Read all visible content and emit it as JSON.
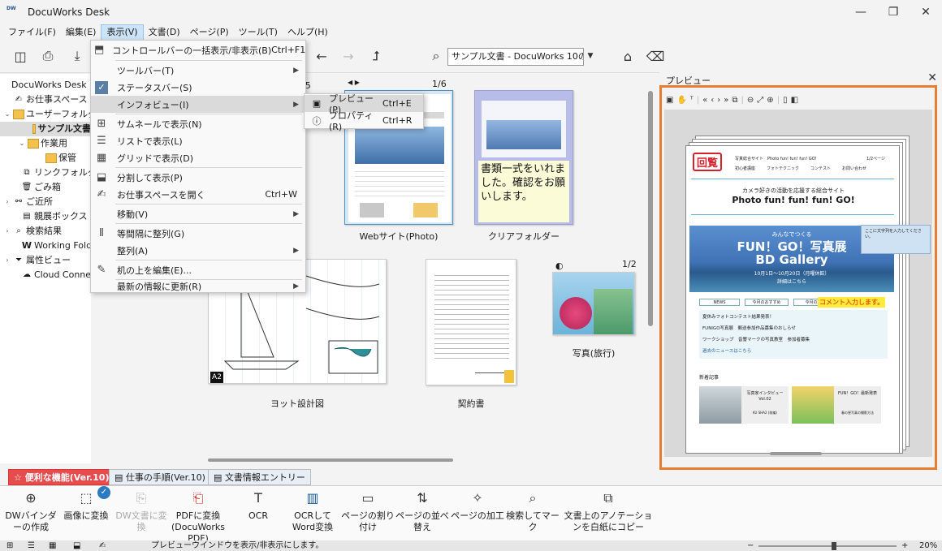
{
  "app": {
    "title": "DocuWorks Desk",
    "logo_text": "DW"
  },
  "window_controls": {
    "minimize": "—",
    "maximize": "❐",
    "close": "✕"
  },
  "menu": [
    "ファイル(F)",
    "編集(E)",
    "表示(V)",
    "文書(D)",
    "ページ(P)",
    "ツール(T)",
    "ヘルプ(H)"
  ],
  "toolbar": {
    "search_value": "サンプル文書 - DocuWorks 10の検"
  },
  "sidebar": {
    "items": [
      {
        "label": "DocuWorks Desk"
      },
      {
        "label": "お仕事スペース"
      },
      {
        "label": "ユーザーフォルダ"
      },
      {
        "label": "サンプル文書"
      },
      {
        "label": "作業用"
      },
      {
        "label": "保管"
      },
      {
        "label": "リンクフォルダ"
      },
      {
        "label": "ごみ箱"
      },
      {
        "label": "ご近所"
      },
      {
        "label": "親展ボックス"
      },
      {
        "label": "検索結果"
      },
      {
        "label": "Working Folde"
      },
      {
        "label": "属性ビュー"
      },
      {
        "label": "Cloud Connect"
      }
    ]
  },
  "view_menu": {
    "items": [
      {
        "label": "コントロールバーの一括表示/非表示(B)",
        "shortcut": "Ctrl+F1"
      },
      {
        "label": "ツールバー(T)"
      },
      {
        "label": "ステータスバー(S)"
      },
      {
        "label": "インフォビュー(I)"
      },
      {
        "label": "サムネールで表示(N)"
      },
      {
        "label": "リストで表示(L)"
      },
      {
        "label": "グリッドで表示(D)"
      },
      {
        "label": "分割して表示(P)"
      },
      {
        "label": "お仕事スペースを開く",
        "shortcut": "Ctrl+W"
      },
      {
        "label": "移動(V)"
      },
      {
        "label": "等間隔に整列(G)"
      },
      {
        "label": "整列(A)"
      },
      {
        "label": "机の上を編集(E)..."
      },
      {
        "label": "最新の情報に更新(R)"
      }
    ],
    "submenu": [
      {
        "label": "プレビュー(P)",
        "shortcut": "Ctrl+E"
      },
      {
        "label": "プロパティ(R)",
        "shortcut": "Ctrl+R"
      }
    ]
  },
  "documents": [
    {
      "label": "Webサイト(Photo)",
      "pages": "1/6"
    },
    {
      "label": "クリアフォルダー",
      "note": "書類一式をいれました。確認をお願いします。"
    },
    {
      "label": "ヨット設計図",
      "badge": "A2"
    },
    {
      "label": "契約書"
    },
    {
      "label": "写真(旅行)",
      "pages": "1/2"
    }
  ],
  "partial_pages": "/5",
  "preview": {
    "title": "プレビュー",
    "stamp": "回覧",
    "doc": {
      "header_site": "写真総合サイト　Photo fun! fun! fun! GO!",
      "header_page": "1/2ページ",
      "nav": [
        "初心者講座",
        "フォトテクニック",
        "コンテスト",
        "お問い合わせ"
      ],
      "subtitle": "カメラ好きの活動を応援する総合サイト",
      "main_title": "Photo fun! fun! fun! GO!",
      "comment_box": "ここに文字列を入力してください。",
      "banner_small": "みんなでつくる",
      "banner_title1": "FUN！GO！写真展",
      "banner_title2": "BD Gallery",
      "banner_date": "10月1日～10月20日（月曜休館）",
      "banner_more": "詳細はこちら",
      "tab_news": "NEWS",
      "tab_recommend": "今月のおすすめ",
      "tab_event": "今月の集会",
      "comment_label": "コメント入力します。",
      "news": [
        "夏休みフォトコンテスト結果発表！",
        "FUNIGO写真展　郵送参加作品募集のおしらせ",
        "ワークショップ　音響マークの写真教室　参加者募集",
        "過去のニュースはこちら"
      ],
      "articles_title": "新着記事",
      "article1": "写真家インタビューVol.02",
      "article2": "FUN！GO！最新発表",
      "article1_sub": "KU SHA2 (前編)",
      "article2_sub": "春の昼写真の撮影方法"
    }
  },
  "bottom_tabs": [
    "便利な機能(Ver.10)",
    "仕事の手順(Ver.10)",
    "文書情報エントリー"
  ],
  "bottom_tools": [
    {
      "label": "DWバインダーの作成"
    },
    {
      "label": "画像に変換"
    },
    {
      "label": "DW文書に変換"
    },
    {
      "label": "PDFに変換(DocuWorks PDF)"
    },
    {
      "label": "OCR"
    },
    {
      "label": "OCRしてWord変換"
    },
    {
      "label": "ページの割り付け"
    },
    {
      "label": "ページの並べ替え"
    },
    {
      "label": "ページの加工"
    },
    {
      "label": "検索してマーク"
    },
    {
      "label": "文書上のアノテーションを白紙にコピー"
    }
  ],
  "status": {
    "message": "プレビューウインドウを表示/非表示にします。",
    "zoom": "20%",
    "zoom_minus": "−",
    "zoom_plus": "+"
  }
}
